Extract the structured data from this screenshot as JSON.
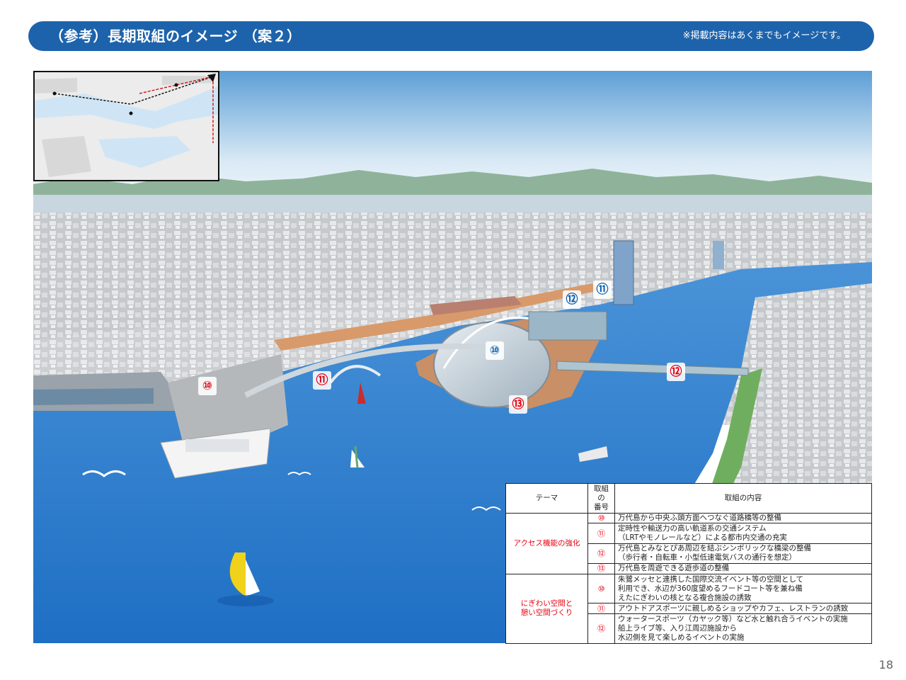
{
  "header": {
    "title": "（参考）長期取組のイメージ （案２）",
    "note": "※掲載内容はあくまでもイメージです。"
  },
  "markers": {
    "m10a": "⑩",
    "m11a": "⑪",
    "m10b": "⑩",
    "m11b": "⑪",
    "m12a": "⑫",
    "m12b": "⑫",
    "m13": "⑬"
  },
  "table": {
    "headers": {
      "theme": "テーマ",
      "number": "取組の\n番号",
      "content": "取組の内容"
    },
    "groups": [
      {
        "theme": "アクセス機能の強化",
        "rows": [
          {
            "number": "⑩",
            "content": "万代島から中央ふ頭方面へつなぐ道路橋等の整備"
          },
          {
            "number": "⑪",
            "content": "定時性や輸送力の高い軌道系の交通システム\n（LRTやモノレールなど）による都市内交通の充実"
          },
          {
            "number": "⑫",
            "content": "万代島とみなとぴあ周辺を結ぶシンボリックな橋梁の整備\n（歩行者・自転車・小型低速電気バスの通行を想定）"
          },
          {
            "number": "⑬",
            "content": "万代島を周遊できる遊歩道の整備"
          }
        ]
      },
      {
        "theme": "にぎわい空間と\n憩い空間づくり",
        "rows": [
          {
            "number": "⑩",
            "content": "朱鷺メッセと連携した国際交流イベント等の空間として\n利用でき、水辺が360度望めるフードコート等を兼ね備\nえたにぎわいの核となる複合施設の誘致"
          },
          {
            "number": "⑪",
            "content": "アウトドアスポーツに親しめるショップやカフェ、レストランの誘致"
          },
          {
            "number": "⑫",
            "content": "ウォータースポーツ（カヤック等）など水と触れ合うイベントの実施\n船上ライブ等、入り江周辺施設から\n水辺側を見て楽しめるイベントの実施"
          }
        ]
      }
    ]
  },
  "page_number": "18",
  "colors": {
    "header_bg": "#1d63ac",
    "marker_red": "#e60012",
    "marker_blue": "#0b5fb0",
    "water": "#2f7fd0"
  }
}
